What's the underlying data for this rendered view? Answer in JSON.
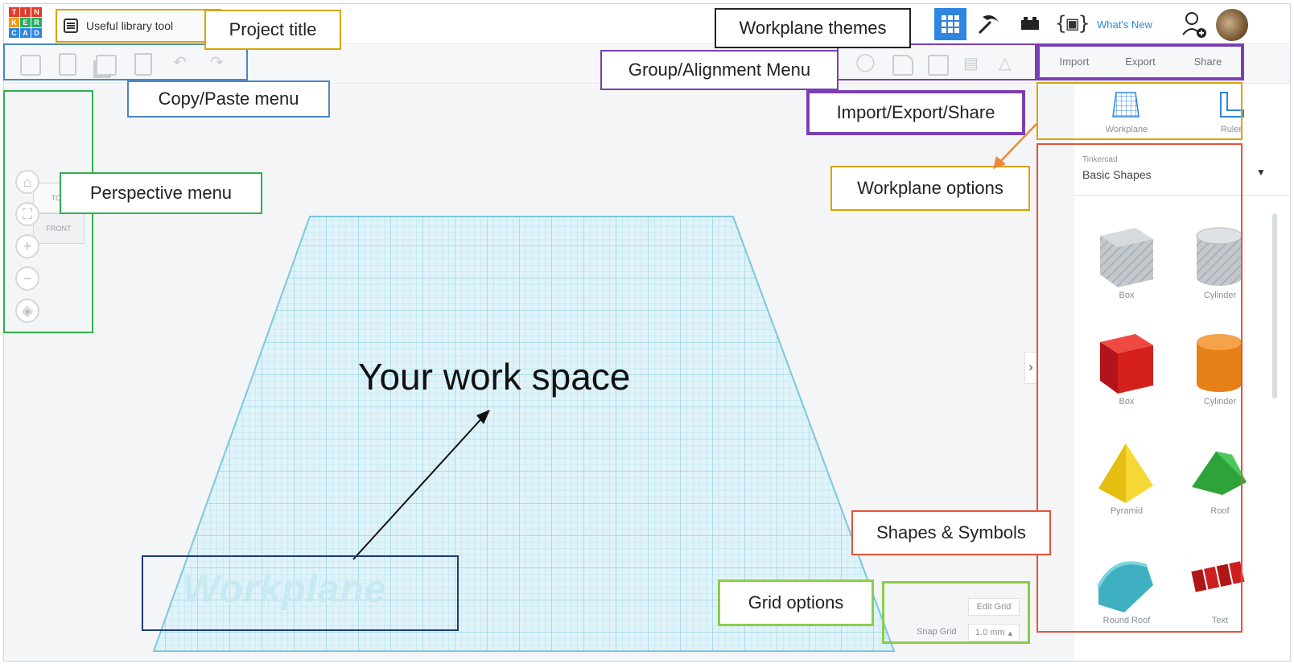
{
  "project": {
    "title": "Useful library tool"
  },
  "header": {
    "whats_new": "What's New"
  },
  "logo": {
    "letters": [
      "T",
      "I",
      "N",
      "K",
      "E",
      "R",
      "C",
      "A",
      "D"
    ]
  },
  "io": {
    "import": "Import",
    "export": "Export",
    "share": "Share"
  },
  "tools": {
    "workplane": "Workplane",
    "ruler": "Ruler"
  },
  "library": {
    "source": "Tinkercad",
    "category": "Basic Shapes"
  },
  "shapes": [
    {
      "name": "Box",
      "color": "#b9bec4"
    },
    {
      "name": "Cylinder",
      "color": "#c4c8cc"
    },
    {
      "name": "Box",
      "color": "#d6201c"
    },
    {
      "name": "Cylinder",
      "color": "#e8801a"
    },
    {
      "name": "Pyramid",
      "color": "#f2d11c"
    },
    {
      "name": "Roof",
      "color": "#2ea33a"
    },
    {
      "name": "Round Roof",
      "color": "#3fb0c2"
    },
    {
      "name": "Text",
      "color": "#cc1f1f"
    }
  ],
  "viewcube": {
    "top": "TOP",
    "front": "FRONT"
  },
  "workplane_text": "Workplane",
  "grid": {
    "edit": "Edit Grid",
    "snap_label": "Snap Grid",
    "snap_value": "1.0 mm"
  },
  "annotations": {
    "project_title": "Project title",
    "copy_paste": "Copy/Paste menu",
    "perspective": "Perspective menu",
    "workplane_themes": "Workplane themes",
    "group_alignment": "Group/Alignment Menu",
    "import_export_share": "Import/Export/Share",
    "workplane_options": "Workplane options",
    "shapes_symbols": "Shapes & Symbols",
    "grid_options": "Grid options",
    "work_space": "Your work space"
  },
  "colors": {
    "yellow": "#d9a400",
    "blue": "#4a86c5",
    "green": "#2fb24c",
    "purple": "#7a3fb5",
    "orange": "#e98a3a",
    "red": "#e5533c",
    "lime": "#8ccc4a",
    "navy": "#1f3a78",
    "grid": "#8fd3e6"
  }
}
